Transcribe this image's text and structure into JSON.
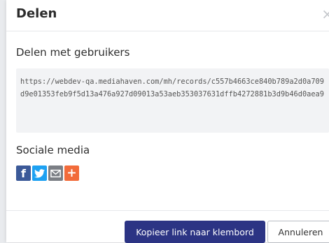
{
  "dialog": {
    "title": "Delen",
    "close_symbol": "×"
  },
  "share_users": {
    "label": "Delen met gebruikers",
    "url": "https://webdev-qa.mediahaven.com/mh/records/c557b4663ce840b789a2d0a709d9e01353feb9f5d13a476a927d09013a53aeb353037631dffb4272881b3d9b46d0aea9"
  },
  "social": {
    "label": "Sociale media",
    "items": [
      {
        "name": "facebook-icon",
        "glyph": "f",
        "color": "#3b5998"
      },
      {
        "name": "twitter-icon",
        "glyph": "",
        "color": "#1da1f2"
      },
      {
        "name": "email-icon",
        "glyph": "",
        "color": "#7b7f85"
      },
      {
        "name": "plus-icon",
        "glyph": "+",
        "color": "#f26b3a"
      }
    ]
  },
  "footer": {
    "copy_label": "Kopieer link naar klembord",
    "cancel_label": "Annuleren"
  }
}
